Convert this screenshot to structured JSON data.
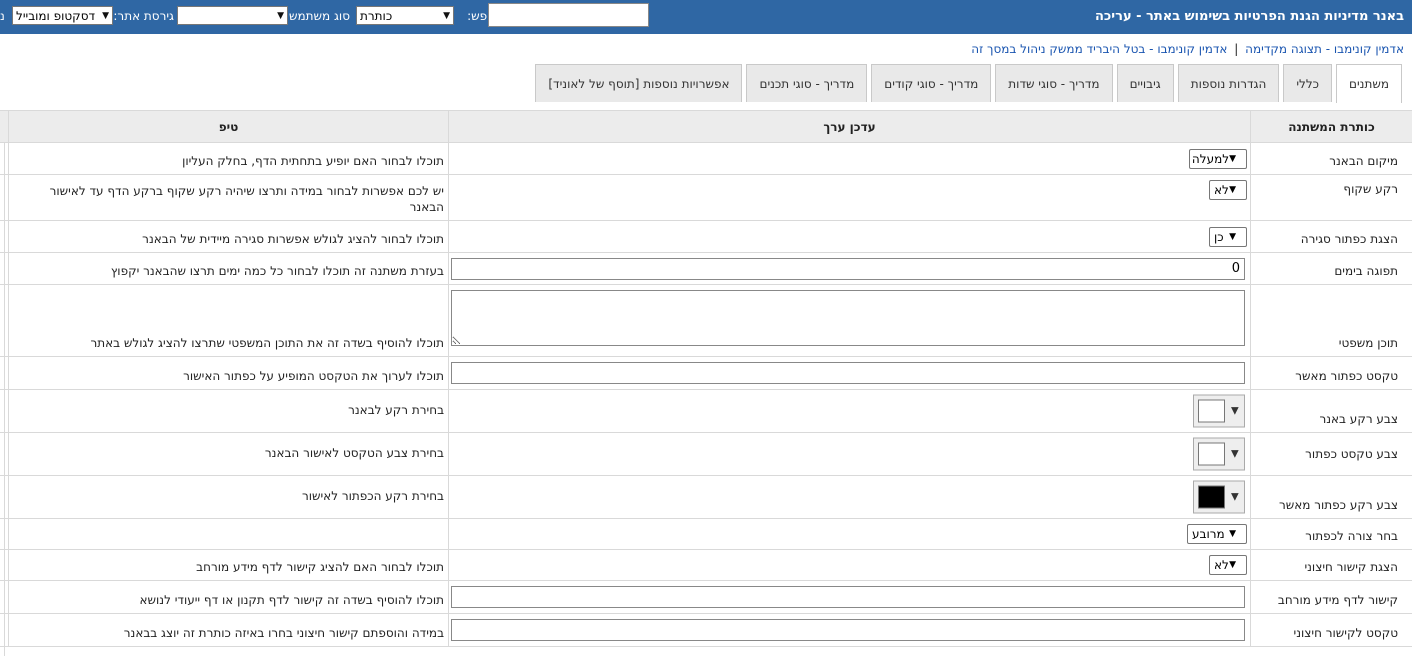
{
  "header": {
    "title": "באנר מדיניות הגנת הפרטיות בשימוש באתר - עריכה",
    "search_label": "חפש:",
    "search_value": "",
    "search_field": "כותרת",
    "user_type_label": "סוג משתמש:",
    "user_type_value": "",
    "site_version_label": "גירסת אתר:",
    "site_version_value": "דסקטופ ומובייל",
    "edge_label": "נ"
  },
  "breadcrumb": {
    "link1": "אדמין קונימבו - תצוגה מקדימה",
    "separator": "|",
    "link2": "אדמין קונימבו - בטל היבריד ממשק ניהול במסך זה"
  },
  "tabs": [
    {
      "label": "משתנים",
      "active": true
    },
    {
      "label": "כללי"
    },
    {
      "label": "הגדרות נוספות"
    },
    {
      "label": "גיבויים"
    },
    {
      "label": "מדריך - סוגי שדות"
    },
    {
      "label": "מדריך - סוגי קודים"
    },
    {
      "label": "מדריך - סוגי תכנים"
    },
    {
      "label": "אפשרויות נוספות [תוסף של לאוניד]"
    }
  ],
  "table": {
    "headers": {
      "name": "כותרת המשתנה",
      "edit": "עדכן ערך",
      "tip": "טיפ"
    },
    "rows": [
      {
        "name": "מיקום הבאנר",
        "value": "למעלה",
        "tip": "תוכלו לבחור האם יופיע בתחתית הדף, בחלק העליון"
      },
      {
        "name": "רקע שקוף",
        "value": "לא",
        "tip": "יש לכם אפשרות לבחור במידה ותרצו שיהיה רקע שקוף ברקע הדף עד לאישור הבאנר"
      },
      {
        "name": "הצגת כפתור סגירה",
        "value": "כן",
        "tip": "תוכלו לבחור להציג לגולש אפשרות סגירה מיידית של הבאנר"
      },
      {
        "name": "תפוגה בימים",
        "value": "0",
        "tip": "בעזרת משתנה זה תוכלו לבחור כל כמה ימים תרצו שהבאנר יקפוץ"
      },
      {
        "name": "תוכן משפטי",
        "value": "",
        "tip": "תוכלו להוסיף בשדה זה את התוכן המשפטי שתרצו להציג לגולש באתר"
      },
      {
        "name": "טקסט כפתור מאשר",
        "value": "",
        "tip": "תוכלו לערוך את הטקסט המופיע על כפתור האישור"
      },
      {
        "name": "צבע רקע באנר",
        "value": "#ffffff",
        "tip": "בחירת רקע לבאנר"
      },
      {
        "name": "צבע טקסט כפתור",
        "value": "#ffffff",
        "tip": "בחירת צבע הטקסט לאישור הבאנר"
      },
      {
        "name": "צבע רקע כפתור מאשר",
        "value": "#000000",
        "tip": "בחירת רקע הכפתור לאישור"
      },
      {
        "name": "בחר צורה לכפתור",
        "value": "מרובע",
        "tip": ""
      },
      {
        "name": "הצגת קישור חיצוני",
        "value": "לא",
        "tip": "תוכלו לבחור האם להציג קישור לדף מידע מורחב"
      },
      {
        "name": "קישור לדף מידע מורחב",
        "value": "",
        "tip": "תוכלו להוסיף בשדה זה קישור לדף תקנון או דף ייעודי לנושא"
      },
      {
        "name": "טקסט לקישור חיצוני",
        "value": "",
        "tip": "במידה והוספתם קישור חיצוני בחרו באיזה כותרת זה יוצג בבאנר"
      }
    ]
  }
}
